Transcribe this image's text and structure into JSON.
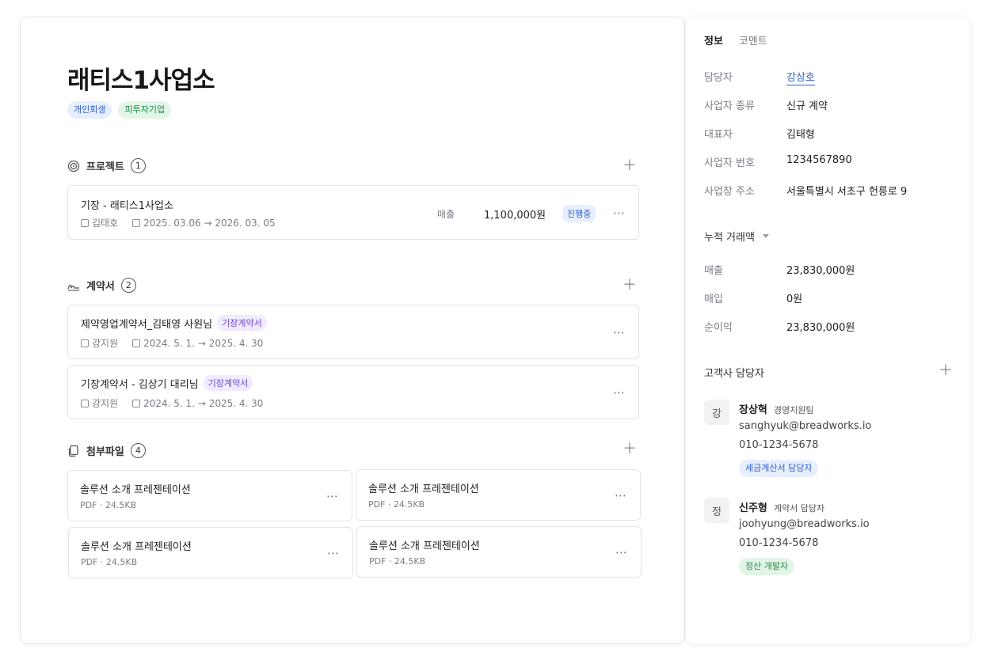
{
  "company": {
    "name": "래티스1사업소",
    "badges": [
      "개인회생",
      "피투자기업"
    ]
  },
  "projects": {
    "title": "프로젝트",
    "count": "1",
    "items": [
      {
        "title": "기장 - 래티스1사업소",
        "person": "김태호",
        "period": "2025. 03.06 → 2026. 03. 05",
        "revenue_label": "매출",
        "amount": "1,100,000원",
        "status": "진행중"
      }
    ]
  },
  "contracts": {
    "title": "계약서",
    "count": "2",
    "items": [
      {
        "title": "제약영업계약서_김태영 사원님",
        "tag": "기장계약서",
        "person": "강지원",
        "period": "2024. 5. 1. → 2025. 4. 30"
      },
      {
        "title": "기장계약서 - 김상기 대리님",
        "tag": "기장계약서",
        "person": "강지원",
        "period": "2024. 5. 1. → 2025. 4. 30"
      }
    ]
  },
  "attachments": {
    "title": "첨부파일",
    "count": "4",
    "items": [
      {
        "name": "솔루션 소개 프레젠테이션",
        "meta": "PDF · 24.5KB"
      },
      {
        "name": "솔루션 소개 프레젠테이션",
        "meta": "PDF · 24.5KB"
      },
      {
        "name": "솔루션 소개 프레젠테이션",
        "meta": "PDF · 24.5KB"
      },
      {
        "name": "솔루션 소개 프레젠테이션",
        "meta": "PDF · 24.5KB"
      }
    ]
  },
  "sidebar": {
    "tabs": [
      "정보",
      "코멘트"
    ],
    "info": [
      {
        "label": "담당자",
        "value": "강상호"
      },
      {
        "label": "사업자 종류",
        "value": "신규 계약"
      },
      {
        "label": "대표자",
        "value": "김태형"
      },
      {
        "label": "사업자 번호",
        "value": "1234567890"
      },
      {
        "label": "사업장 주소",
        "value": "서울특별시 서초구 헌릉로 9"
      }
    ],
    "totals_title": "누적 거래액",
    "totals": [
      {
        "label": "매출",
        "value": "23,830,000원"
      },
      {
        "label": "매입",
        "value": "0원"
      },
      {
        "label": "순이익",
        "value": "23,830,000원"
      }
    ],
    "contacts_title": "고객사 담당자",
    "contacts": [
      {
        "avatar": "강",
        "name": "장상혁",
        "role": "경영지원팀",
        "email": "sanghyuk@breadworks.io",
        "phone": "010-1234-5678",
        "tag": "세금계산서 담당자"
      },
      {
        "avatar": "정",
        "name": "신주형",
        "role": "계약서 담당자",
        "email": "joohyung@breadworks.io",
        "phone": "010-1234-5678",
        "tag": "정산 개발자"
      }
    ]
  },
  "colors": {
    "accent_blue": "#2f5ec9",
    "badge_green": "#24894a",
    "badge_purple": "#6c47c9"
  }
}
